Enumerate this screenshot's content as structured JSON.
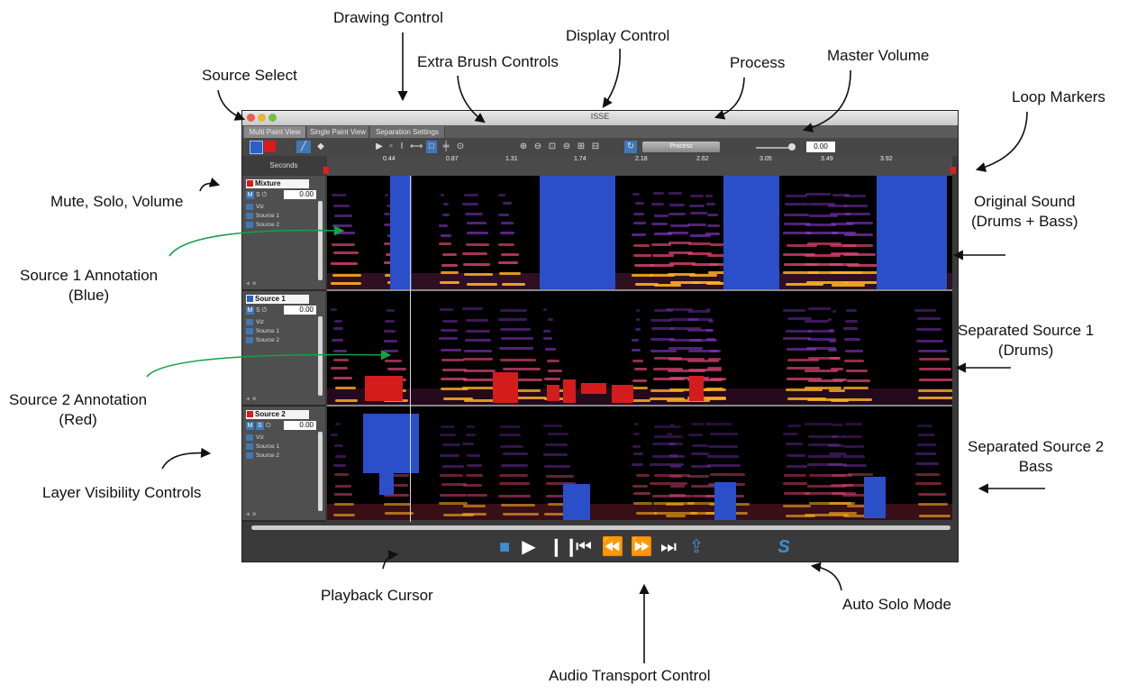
{
  "annotations": {
    "drawing_control": "Drawing Control",
    "display_control": "Display Control",
    "extra_brush_controls": "Extra Brush Controls",
    "process": "Process",
    "master_volume": "Master Volume",
    "source_select": "Source Select",
    "loop_markers": "Loop Markers",
    "mute_solo_volume": "Mute, Solo, Volume",
    "original_sound": [
      "Original Sound",
      "(Drums + Bass)"
    ],
    "source1_annotation": [
      "Source 1 Annotation",
      "(Blue)"
    ],
    "separated_source1": [
      "Separated Source 1",
      "(Drums)"
    ],
    "source2_annotation": [
      "Source 2 Annotation",
      "(Red)"
    ],
    "separated_source2": [
      "Separated Source 2",
      "Bass"
    ],
    "layer_visibility": "Layer Visibility Controls",
    "playback_cursor": "Playback Cursor",
    "auto_solo_mode": "Auto Solo Mode",
    "audio_transport": "Audio Transport Control"
  },
  "window": {
    "title": "ISSE",
    "tabs": [
      "Multi Paint View",
      "Single Paint View",
      "Separation Settings"
    ],
    "active_tab": 0
  },
  "toolbar": {
    "process_label": "Process",
    "master_volume": "0.00",
    "source_colors": [
      "#2a5fc4",
      "#e01818"
    ]
  },
  "ruler": {
    "label": "Seconds",
    "ticks": [
      "0.44",
      "0.87",
      "1.31",
      "1.74",
      "2.18",
      "2.62",
      "3.05",
      "3.49",
      "3.92"
    ]
  },
  "tracks": [
    {
      "name": "Mixture",
      "color": "#e01818",
      "volume": "0.00",
      "layers": [
        "Viz",
        "Source 1",
        "Source 2"
      ]
    },
    {
      "name": "Source 1",
      "color": "#2a5fc4",
      "volume": "0.00",
      "layers": [
        "Viz",
        "Source 1",
        "Source 2"
      ]
    },
    {
      "name": "Source 2",
      "color": "#e01818",
      "volume": "0.00",
      "layers": [
        "Viz",
        "Source 1",
        "Source 2"
      ]
    }
  ],
  "icons": {
    "toolbar": [
      "blue-source-icon",
      "red-source-icon",
      "brush-icon",
      "eraser-icon",
      "select-icon",
      "zoom-in-icon",
      "zoom-out-icon",
      "process-icon",
      "volume-slider-icon"
    ],
    "transport": [
      "stop-icon",
      "play-icon",
      "pause-icon",
      "skip-start-icon",
      "rewind-icon",
      "fast-forward-icon",
      "skip-end-icon",
      "loop-icon",
      "auto-solo-icon"
    ]
  },
  "colors": {
    "source1_blue": "#2a4fc8",
    "source2_red": "#d41c1c",
    "transport_accent": "#3f8fd0"
  }
}
